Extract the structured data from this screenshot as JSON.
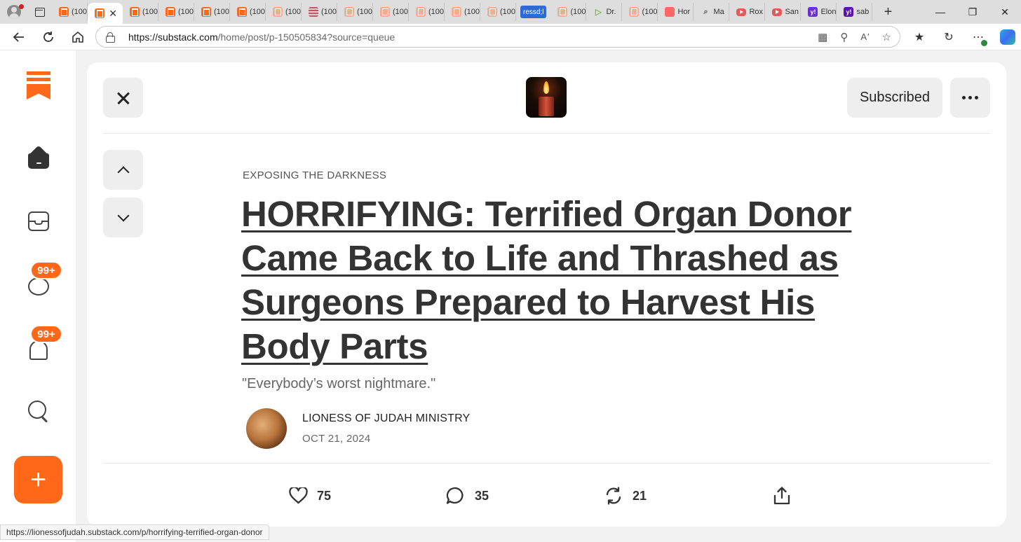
{
  "browser": {
    "url_domain": "https://substack.com",
    "url_path": "/home/post/p-150505834?source=queue",
    "tabs": [
      {
        "label": "(100",
        "icon": "substack-icon"
      },
      {
        "label": "",
        "icon": "substack-icon",
        "active": true,
        "close": "✕"
      },
      {
        "label": "(100",
        "icon": "substack-icon"
      },
      {
        "label": "(100",
        "icon": "substack-icon"
      },
      {
        "label": "(100",
        "icon": "substack-icon"
      },
      {
        "label": "(100",
        "icon": "substack-icon"
      },
      {
        "label": "(100",
        "icon": "substack-faded-icon"
      },
      {
        "label": "(100",
        "icon": "grid-icon"
      },
      {
        "label": "(100",
        "icon": "substack-faded-icon"
      },
      {
        "label": "(100",
        "icon": "substack-faded-icon"
      },
      {
        "label": "(100",
        "icon": "substack-faded-icon"
      },
      {
        "label": "(100",
        "icon": "substack-faded-icon"
      },
      {
        "label": "(100",
        "icon": "substack-faded-icon"
      },
      {
        "label": "ressd;l",
        "icon": "tab-group"
      },
      {
        "label": "(100",
        "icon": "substack-faded-icon"
      },
      {
        "label": "Dr.",
        "icon": "play-icon"
      },
      {
        "label": "(100",
        "icon": "substack-faded-icon"
      },
      {
        "label": "Hor",
        "icon": "red-icon"
      },
      {
        "label": "Ma",
        "icon": "search-icon"
      },
      {
        "label": "Rox",
        "icon": "youtube-icon"
      },
      {
        "label": "San",
        "icon": "youtube-icon"
      },
      {
        "label": "Elon",
        "icon": "yahoo-icon"
      },
      {
        "label": "sab",
        "icon": "yahoo-dark-icon"
      }
    ],
    "new_tab": "+",
    "status_url": "https://lionessofjudah.substack.com/p/horrifying-terrified-organ-donor"
  },
  "nav": {
    "chat_badge": "99+",
    "notifications_badge": "99+",
    "compose_label": "+"
  },
  "post": {
    "subscribe_label": "Subscribed",
    "section": "EXPOSING THE DARKNESS",
    "title": "HORRIFYING: Terrified Organ Donor Came Back to Life and Thrashed as Surgeons Prepared to Harvest His Body Parts",
    "subtitle": "\"Everybody’s worst nightmare.\"",
    "author": "LIONESS OF JUDAH MINISTRY",
    "date": "OCT 21, 2024",
    "likes": "75",
    "comments": "35",
    "restacks": "21"
  },
  "colors": {
    "accent": "#ff6719",
    "text": "#333333",
    "button_bg": "#eeeeee"
  }
}
